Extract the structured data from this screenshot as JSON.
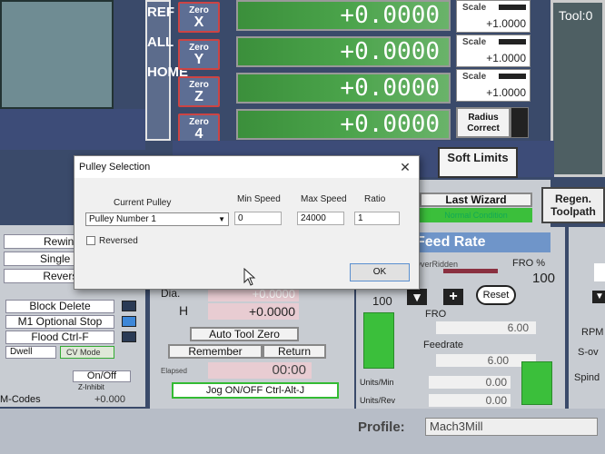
{
  "ref_all_home": [
    "REF",
    "ALL",
    "HOME"
  ],
  "axes": [
    {
      "zero_top": "Zero",
      "zero_axis": "X",
      "dro": "+0.0000",
      "scale_label": "Scale",
      "scale_value": "+1.0000"
    },
    {
      "zero_top": "Zero",
      "zero_axis": "Y",
      "dro": "+0.0000",
      "scale_label": "Scale",
      "scale_value": "+1.0000"
    },
    {
      "zero_top": "Zero",
      "zero_axis": "Z",
      "dro": "+0.0000",
      "scale_label": "Scale",
      "scale_value": "+1.0000"
    },
    {
      "zero_top": "Zero",
      "zero_axis": "4",
      "dro": "+0.0000"
    }
  ],
  "radius_correct": "Radius Correct",
  "soft_limits": "Soft Limits",
  "tool_label": "Tool:0",
  "last_wizard": "Last Wizard",
  "normal_condition": "Normal Condition",
  "regen_toolpath": "Regen. Toolpath",
  "left_buttons": [
    "Rewind Ctrl",
    "Single BLK A",
    "Reverse Ru"
  ],
  "left_toggles": [
    "Block Delete",
    "M1 Optional Stop",
    "Flood Ctrl-F"
  ],
  "dwell": "Dwell",
  "cv_mode": "CV Mode",
  "on_off": "On/Off",
  "z_inhibit": "Z-Inhibit",
  "z_inhibit_value": "+0.000",
  "m_codes": "M-Codes",
  "dia_label": "Dia.",
  "dia_value": "+0.0000",
  "h_label": "H",
  "h_value": "+0.0000",
  "auto_tool_zero": "Auto Tool Zero",
  "remember": "Remember",
  "return": "Return",
  "elapsed_label": "Elapsed",
  "elapsed_value": "00:00",
  "jog": "Jog ON/OFF Ctrl-Alt-J",
  "feed_rate": "Feed Rate",
  "overridden": "OverRidden",
  "fro_pct_label": "FRO %",
  "fro_pct": "100",
  "fro_left": "100",
  "reset": "Reset",
  "fro_label": "FRO",
  "fro_value": "6.00",
  "feedrate_label": "Feedrate",
  "feedrate_value": "6.00",
  "units_min": "Units/Min",
  "units_min_value": "0.00",
  "units_rev": "Units/Rev",
  "units_rev_value": "0.00",
  "rpm": "RPM",
  "s_ov": "S-ov",
  "spind": "Spind",
  "profile_label": "Profile:",
  "profile_value": "Mach3Mill",
  "dialog": {
    "title": "Pulley Selection",
    "current_pulley_label": "Current Pulley",
    "current_pulley_value": "Pulley Number 1",
    "min_speed_label": "Min Speed",
    "min_speed_value": "0",
    "max_speed_label": "Max Speed",
    "max_speed_value": "24000",
    "ratio_label": "Ratio",
    "ratio_value": "1",
    "reversed_label": "Reversed",
    "ok": "OK"
  }
}
